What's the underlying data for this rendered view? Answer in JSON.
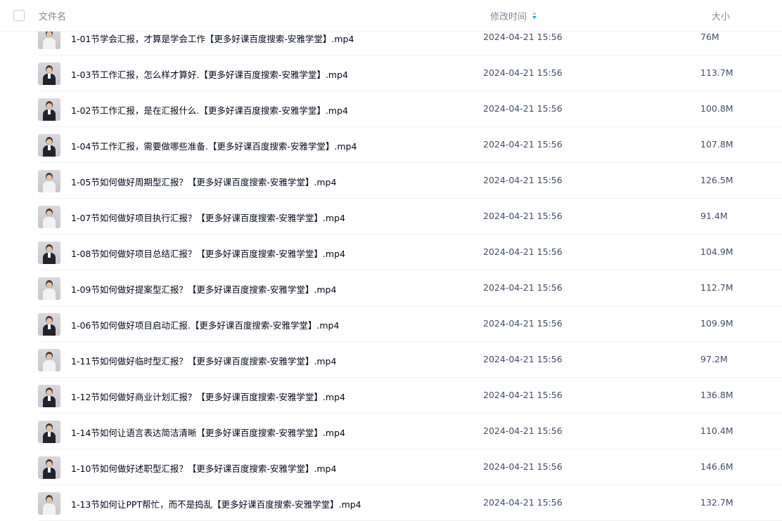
{
  "header": {
    "name_label": "文件名",
    "time_label": "修改时间",
    "size_label": "大小",
    "sort_icon": "sort-icon",
    "accent_color": "#06a7ff"
  },
  "files": [
    {
      "name": "1-01节学会汇报，才算是学会工作【更多好课百度搜索-安雅学堂】.mp4",
      "time": "2024-04-21 15:56",
      "size": "76M",
      "thumb": "video-thumbnail",
      "outfit": "light"
    },
    {
      "name": "1-03节工作汇报，怎么样才算好.【更多好课百度搜索-安雅学堂】.mp4",
      "time": "2024-04-21 15:56",
      "size": "113.7M",
      "thumb": "video-thumbnail",
      "outfit": "dark"
    },
    {
      "name": "1-02节工作汇报，是在汇报什么.【更多好课百度搜索-安雅学堂】.mp4",
      "time": "2024-04-21 15:56",
      "size": "100.8M",
      "thumb": "video-thumbnail",
      "outfit": "dark"
    },
    {
      "name": "1-04节工作汇报，需要做哪些准备.【更多好课百度搜索-安雅学堂】.mp4",
      "time": "2024-04-21 15:56",
      "size": "107.8M",
      "thumb": "video-thumbnail",
      "outfit": "dark"
    },
    {
      "name": "1-05节如何做好周期型汇报？【更多好课百度搜索-安雅学堂】.mp4",
      "time": "2024-04-21 15:56",
      "size": "126.5M",
      "thumb": "video-thumbnail",
      "outfit": "light"
    },
    {
      "name": "1-07节如何做好项目执行汇报？【更多好课百度搜索-安雅学堂】.mp4",
      "time": "2024-04-21 15:56",
      "size": "91.4M",
      "thumb": "video-thumbnail",
      "outfit": "light"
    },
    {
      "name": "1-08节如何做好项目总结汇报？【更多好课百度搜索-安雅学堂】.mp4",
      "time": "2024-04-21 15:56",
      "size": "104.9M",
      "thumb": "video-thumbnail",
      "outfit": "dark"
    },
    {
      "name": "1-09节如何做好提案型汇报？【更多好课百度搜索-安雅学堂】.mp4",
      "time": "2024-04-21 15:56",
      "size": "112.7M",
      "thumb": "video-thumbnail",
      "outfit": "light"
    },
    {
      "name": "1-06节如何做好项目启动汇报.【更多好课百度搜索-安雅学堂】.mp4",
      "time": "2024-04-21 15:56",
      "size": "109.9M",
      "thumb": "video-thumbnail",
      "outfit": "dark"
    },
    {
      "name": "1-11节如何做好临时型汇报？【更多好课百度搜索-安雅学堂】.mp4",
      "time": "2024-04-21 15:56",
      "size": "97.2M",
      "thumb": "video-thumbnail",
      "outfit": "light"
    },
    {
      "name": "1-12节如何做好商业计划汇报？【更多好课百度搜索-安雅学堂】.mp4",
      "time": "2024-04-21 15:56",
      "size": "136.8M",
      "thumb": "video-thumbnail",
      "outfit": "dark"
    },
    {
      "name": "1-14节如何让语言表达简洁清晰【更多好课百度搜索-安雅学堂】.mp4",
      "time": "2024-04-21 15:56",
      "size": "110.4M",
      "thumb": "video-thumbnail",
      "outfit": "dark"
    },
    {
      "name": "1-10节如何做好述职型汇报？【更多好课百度搜索-安雅学堂】.mp4",
      "time": "2024-04-21 15:56",
      "size": "146.6M",
      "thumb": "video-thumbnail",
      "outfit": "dark"
    },
    {
      "name": "1-13节如何让PPT帮忙，而不是捣乱【更多好课百度搜索-安雅学堂】.mp4",
      "time": "2024-04-21 15:56",
      "size": "132.7M",
      "thumb": "video-thumbnail",
      "outfit": "light"
    }
  ]
}
